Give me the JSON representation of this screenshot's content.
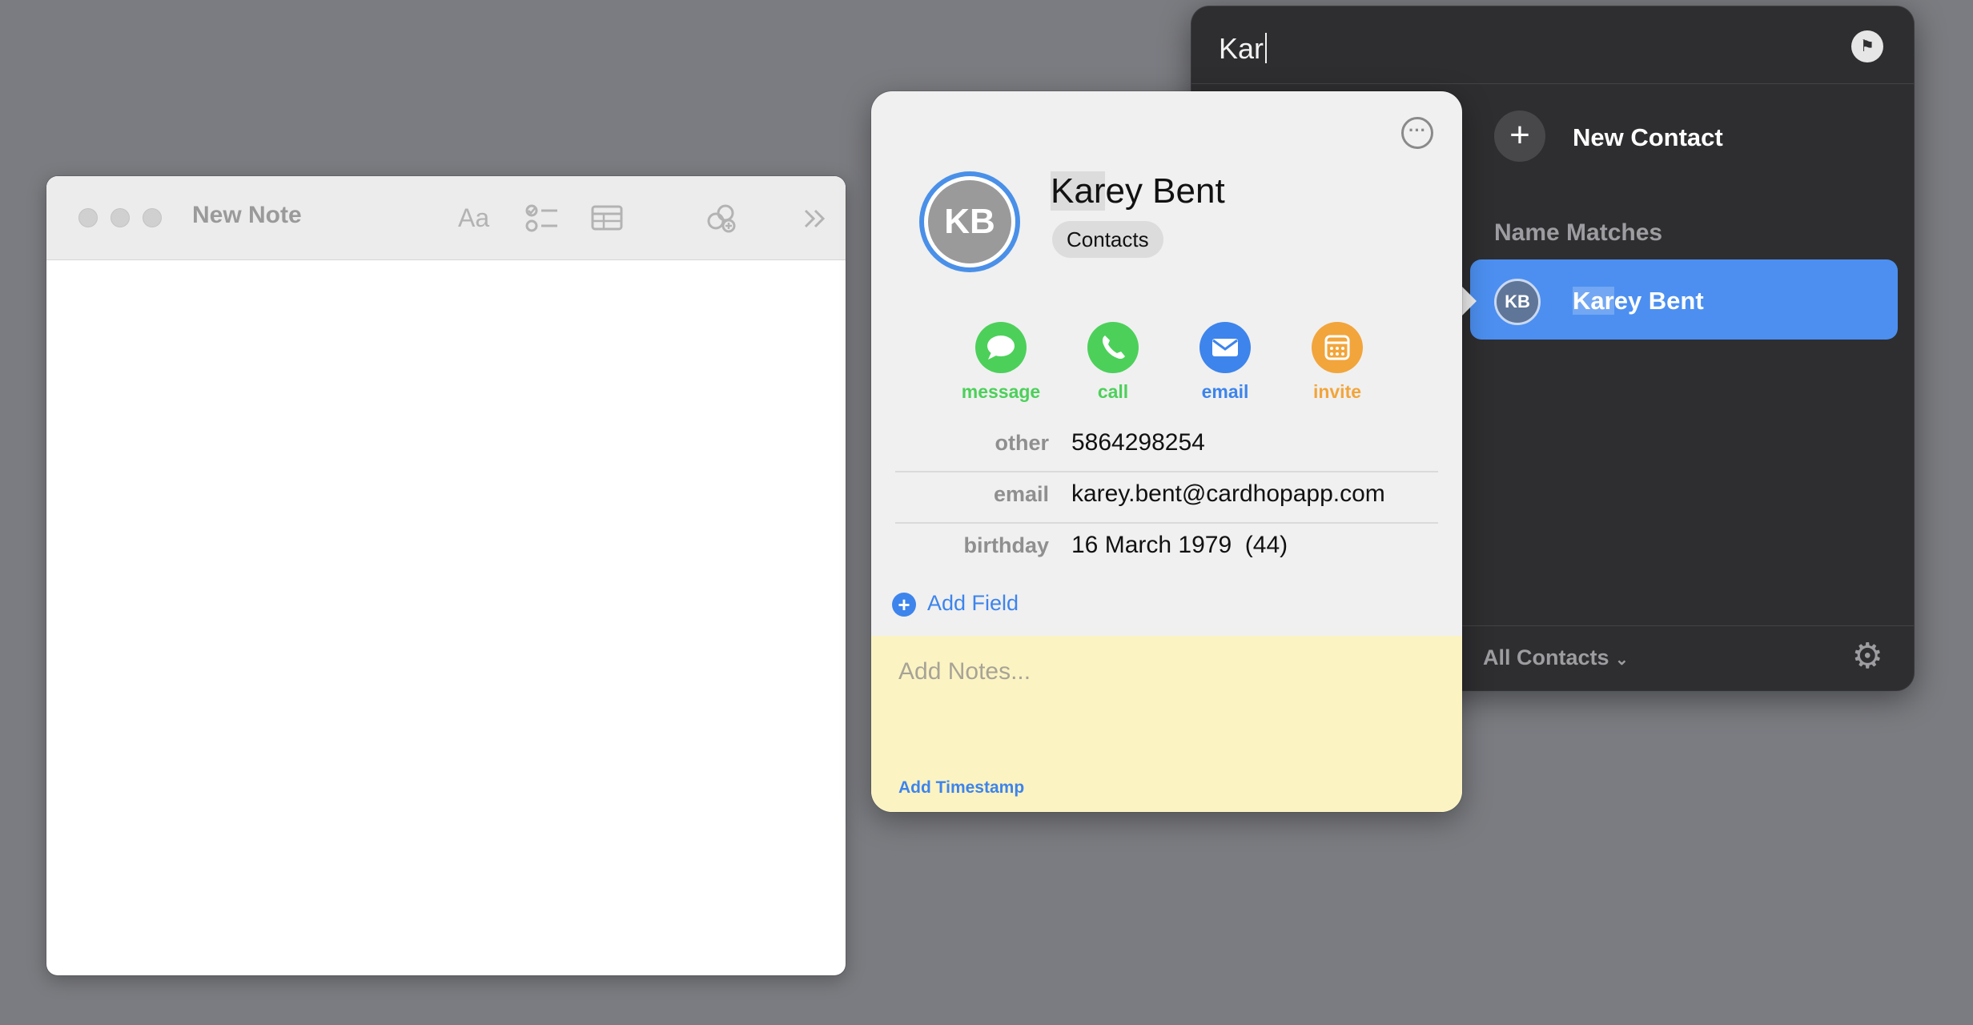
{
  "note": {
    "title": "New Note",
    "toolbar_icons": [
      "text-format-icon",
      "checklist-icon",
      "table-icon",
      "link-share-icon",
      "more-chevron-icon"
    ],
    "format_glyph": "Aa"
  },
  "cardhop": {
    "search_value": "Kar",
    "new_contact_label": "New Contact",
    "section_title": "Name Matches",
    "matches": [
      {
        "initials": "KB",
        "name_highlight": "Kar",
        "name_rest": "ey Bent"
      }
    ],
    "footer_filter": "All Contacts",
    "colors": {
      "accent": "#4c8ff0",
      "panel": "#2e2e30"
    }
  },
  "contact": {
    "initials": "KB",
    "name_highlight": "Kar",
    "name_rest": "ey Bent",
    "group": "Contacts",
    "actions": [
      {
        "label": "message",
        "color": "#4cd05a"
      },
      {
        "label": "call",
        "color": "#4cd05a"
      },
      {
        "label": "email",
        "color": "#3d84ec"
      },
      {
        "label": "invite",
        "color": "#f2a53b"
      }
    ],
    "fields": [
      {
        "label": "other",
        "value": "5864298254"
      },
      {
        "label": "email",
        "value": "karey.bent@cardhopapp.com"
      },
      {
        "label": "birthday",
        "value": "16 March 1979  (44)"
      }
    ],
    "add_field_label": "Add Field",
    "notes_placeholder": "Add Notes...",
    "add_timestamp_label": "Add Timestamp"
  }
}
